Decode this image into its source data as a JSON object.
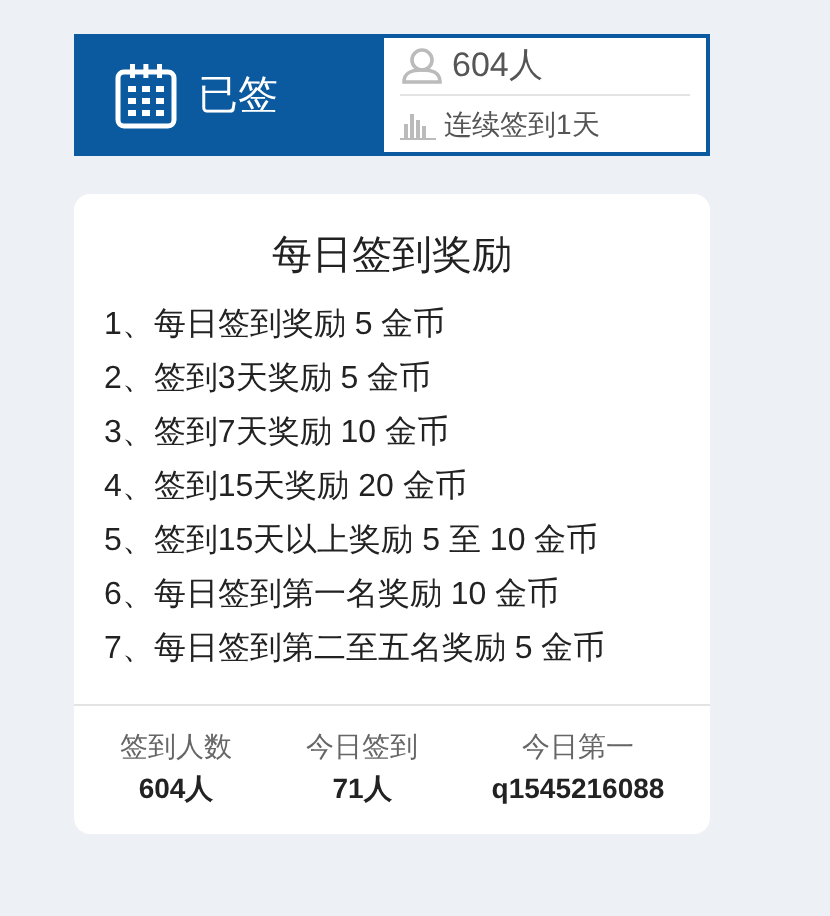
{
  "checkin": {
    "button_label": "已签",
    "people": "604人",
    "streak": "连续签到1天"
  },
  "rewards": {
    "title": "每日签到奖励",
    "items": [
      "1、每日签到奖励 5 金币",
      "2、签到3天奖励 5 金币",
      "3、签到7天奖励 10 金币",
      "4、签到15天奖励 20 金币",
      "5、签到15天以上奖励 5 至 10 金币",
      "6、每日签到第一名奖励 10 金币",
      "7、每日签到第二至五名奖励 5 金币"
    ]
  },
  "stats": [
    {
      "label": "签到人数",
      "value": "604人"
    },
    {
      "label": "今日签到",
      "value": "71人"
    },
    {
      "label": "今日第一",
      "value": "q1545216088"
    }
  ]
}
